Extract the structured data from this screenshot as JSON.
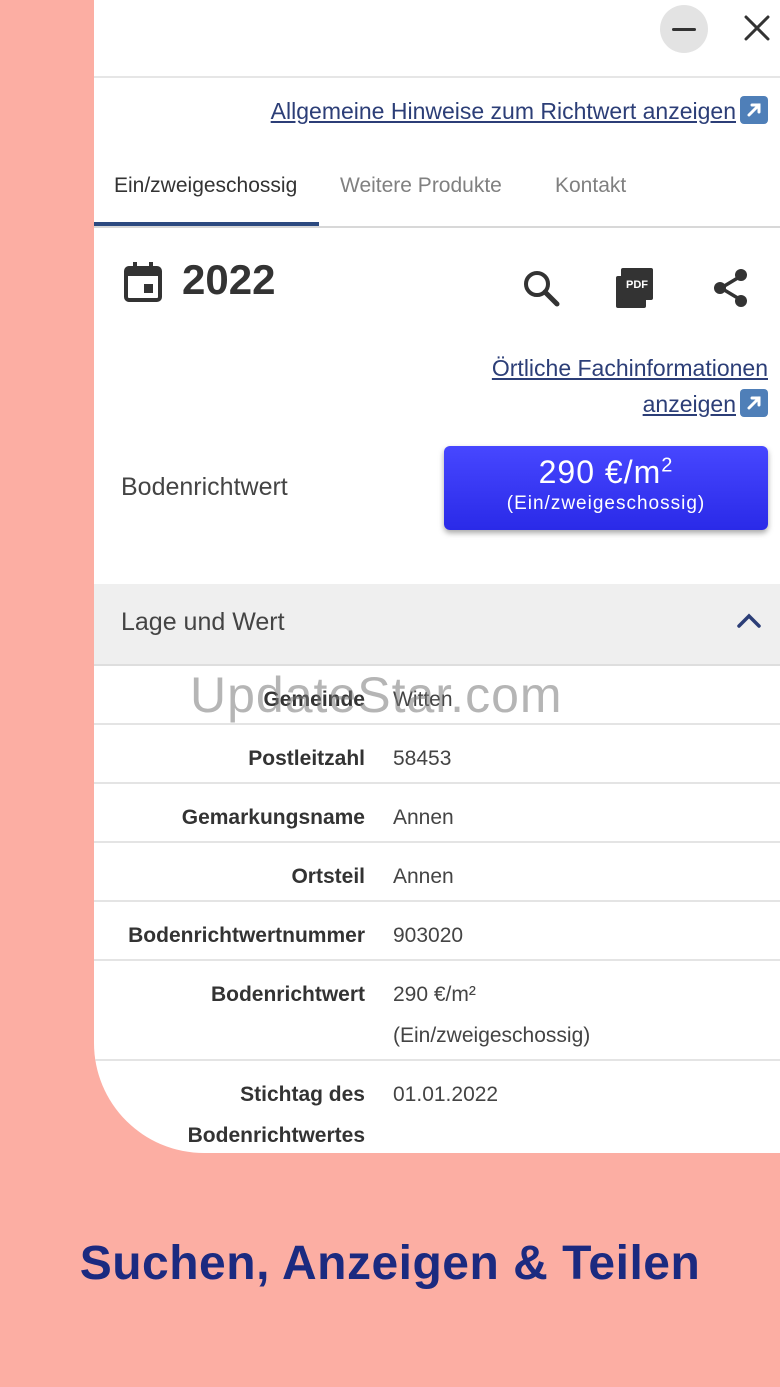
{
  "links": {
    "general_hints": "Allgemeine Hinweise zum Richtwert anzeigen",
    "local_info_line1": "Örtliche Fachinformationen",
    "local_info_line2": "anzeigen"
  },
  "tabs": [
    {
      "label": "Ein/zweigeschossig",
      "active": true
    },
    {
      "label": "Weitere Produkte",
      "active": false
    },
    {
      "label": "Kontakt",
      "active": false
    }
  ],
  "year": "2022",
  "toolbar_icons": [
    "search-icon",
    "pdf-icon",
    "share-icon"
  ],
  "bodenrichtwert": {
    "label": "Bodenrichtwert",
    "value": "290 €/m",
    "unit_sup": "2",
    "sub": "(Ein/zweigeschossig)"
  },
  "section": {
    "title": "Lage und Wert",
    "expanded": true
  },
  "table": [
    {
      "key": "Gemeinde",
      "value": "Witten"
    },
    {
      "key": "Postleitzahl",
      "value": "58453"
    },
    {
      "key": "Gemarkungsname",
      "value": "Annen"
    },
    {
      "key": "Ortsteil",
      "value": "Annen"
    },
    {
      "key": "Bodenrichtwertnummer",
      "value": "903020"
    },
    {
      "key": "Bodenrichtwert",
      "value": "290 €/m²",
      "value2": "(Ein/zweigeschossig)"
    },
    {
      "key": "Stichtag des",
      "key2": "Bodenrichtwertes",
      "value": "01.01.2022"
    }
  ],
  "watermark": "UpdateStar.com",
  "promo": "Suchen, Anzeigen & Teilen",
  "colors": {
    "background": "#fcaea3",
    "accent_button": "#3a3af5",
    "link": "#2c3e77",
    "promo_text": "#1b2a80"
  }
}
